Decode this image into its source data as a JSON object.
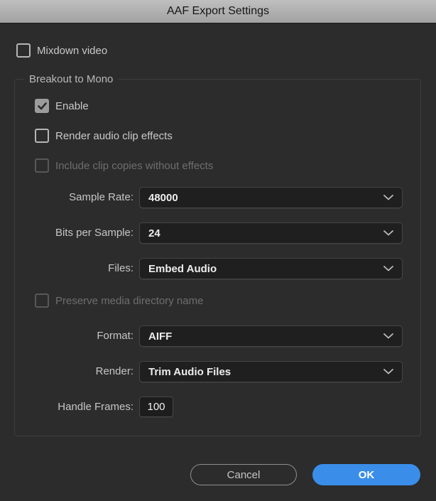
{
  "window": {
    "title": "AAF Export Settings"
  },
  "colors": {
    "dialog_bg": "#2c2c2c",
    "titlebar_top": "#bfbfbf",
    "titlebar_bottom": "#a2a2a2",
    "field_bg": "#1f1f1f",
    "accent_blue": "#3a8ee9",
    "checkbox_checked_fill": "#9c9c9c"
  },
  "mixdown_video": {
    "label": "Mixdown video",
    "checked": false
  },
  "breakout": {
    "legend": "Breakout to Mono",
    "enable": {
      "label": "Enable",
      "checked": true
    },
    "render_effects": {
      "label": "Render audio clip effects",
      "checked": false
    },
    "include_copies": {
      "label": "Include clip copies without effects",
      "checked": false,
      "disabled": true
    },
    "sample_rate": {
      "label": "Sample Rate:",
      "value": "48000"
    },
    "bits_per_sample": {
      "label": "Bits per Sample:",
      "value": "24"
    },
    "files": {
      "label": "Files:",
      "value": "Embed Audio"
    },
    "preserve_dir": {
      "label": "Preserve media directory name",
      "checked": false,
      "disabled": true
    },
    "format": {
      "label": "Format:",
      "value": "AIFF"
    },
    "render": {
      "label": "Render:",
      "value": "Trim Audio Files"
    },
    "handle_frames": {
      "label": "Handle Frames:",
      "value": "100"
    }
  },
  "buttons": {
    "cancel": "Cancel",
    "ok": "OK"
  }
}
